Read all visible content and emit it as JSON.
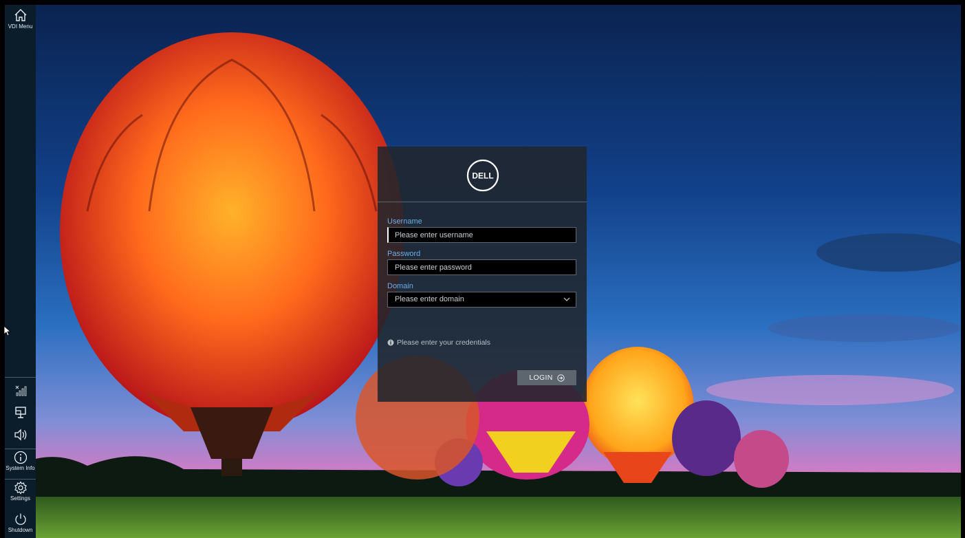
{
  "sidebar": {
    "vdi_menu_label": "VDI Menu",
    "system_info_label": "System Info",
    "settings_label": "Settings",
    "shutdown_label": "Shutdown"
  },
  "login": {
    "brand": "DELL",
    "username_label": "Username",
    "username_placeholder": "Please enter username",
    "password_label": "Password",
    "password_placeholder": "Please enter password",
    "domain_label": "Domain",
    "domain_placeholder": "Please enter domain",
    "info_message": "Please enter your credentials",
    "login_button": "LOGIN"
  },
  "colors": {
    "sidebar_bg": "#0b1c2a",
    "dialog_bg": "#20262c",
    "label_accent": "#6aaee6",
    "button_bg": "#5d666e"
  },
  "icons": [
    "home-icon",
    "network-disconnected-icon",
    "display-icon",
    "volume-icon",
    "info-icon",
    "gear-icon",
    "power-icon",
    "dell-logo",
    "chevron-down-icon",
    "login-arrow-icon",
    "info-circle-icon"
  ]
}
